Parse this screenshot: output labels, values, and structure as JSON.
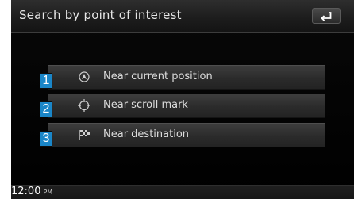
{
  "header": {
    "title": "Search by point of interest",
    "back_icon": "back-arrow-icon"
  },
  "menu": {
    "items": [
      {
        "number": "1",
        "label": "Near current position",
        "icon": "current-position-icon"
      },
      {
        "number": "2",
        "label": "Near scroll mark",
        "icon": "crosshair-icon"
      },
      {
        "number": "3",
        "label": "Near destination",
        "icon": "checkered-flag-icon"
      }
    ]
  },
  "status_bar": {
    "time": "12:00",
    "ampm": "PM"
  },
  "colors": {
    "badge": "#1a86c8",
    "background": "#000000",
    "item": "#333333",
    "text": "#dddddd"
  }
}
